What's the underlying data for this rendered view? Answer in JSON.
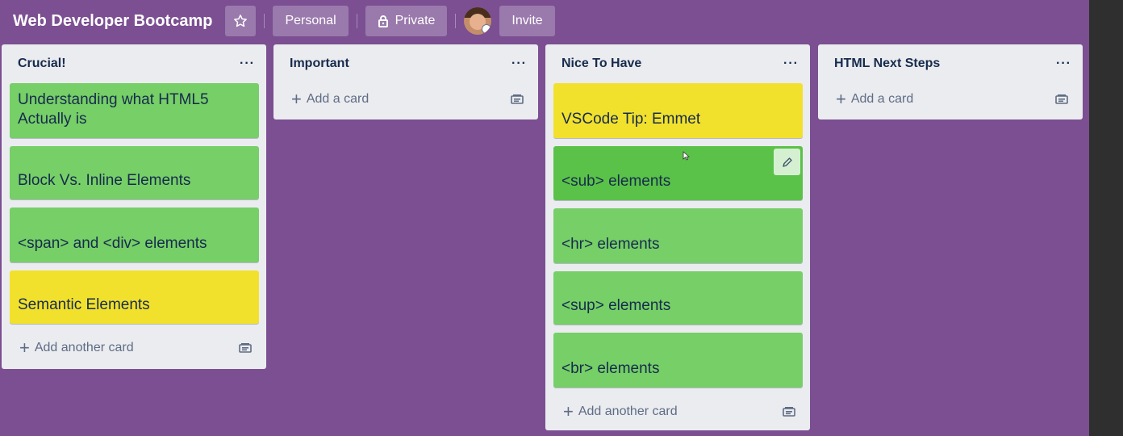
{
  "header": {
    "board_title": "Web Developer Bootcamp",
    "personal_label": "Personal",
    "private_label": "Private",
    "invite_label": "Invite"
  },
  "colors": {
    "board_bg": "#7b4f92",
    "list_bg": "#ebecf0",
    "card_green": "#76cf67",
    "card_yellow": "#f2e12c"
  },
  "lists": [
    {
      "title": "Crucial!",
      "cards": [
        {
          "text": "Understanding what HTML5 Actually is",
          "color": "green"
        },
        {
          "text": "Block Vs. Inline Elements",
          "color": "green"
        },
        {
          "text": "<span> and <div> elements",
          "color": "green"
        },
        {
          "text": "Semantic Elements",
          "color": "yellow"
        }
      ],
      "add_label": "Add another card"
    },
    {
      "title": "Important",
      "cards": [],
      "add_label": "Add a card"
    },
    {
      "title": "Nice To Have",
      "cards": [
        {
          "text": "VSCode Tip: Emmet",
          "color": "yellow"
        },
        {
          "text": "<sub> elements",
          "color": "green"
        },
        {
          "text": "<hr> elements",
          "color": "green"
        },
        {
          "text": "<sup> elements",
          "color": "green"
        },
        {
          "text": "<br> elements",
          "color": "green"
        }
      ],
      "add_label": "Add another card"
    },
    {
      "title": "HTML Next Steps",
      "cards": [],
      "add_label": "Add a card"
    }
  ],
  "icons": {
    "star": "star-icon",
    "lock": "lock-icon",
    "more": "ellipsis-icon",
    "plus": "plus-icon",
    "template": "card-template-icon",
    "edit": "pencil-icon"
  },
  "more_glyph": "···"
}
